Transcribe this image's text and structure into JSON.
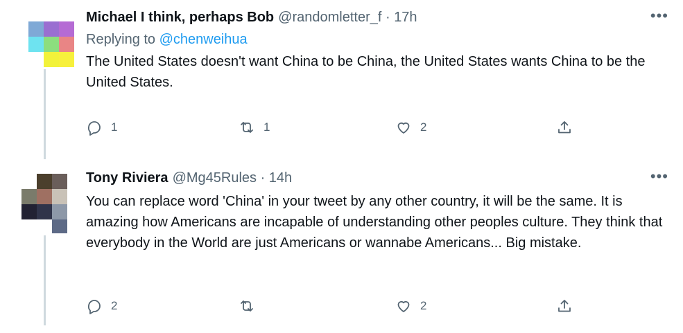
{
  "tweets": [
    {
      "name": "Michael I think, perhaps Bob",
      "meta": "@randomletter_f · 17h",
      "replying_prefix": "Replying to ",
      "replying_handle": "@chenweihua",
      "text": "The United States doesn't want China to be China, the United States wants China to be the United States.",
      "reply_count": "1",
      "retweet_count": "1",
      "like_count": "2",
      "more_glyph": "•••"
    },
    {
      "name": "Tony Riviera",
      "meta": "@Mg45Rules · 14h",
      "text": "You can replace word 'China' in your tweet by any other country, it will be the same. It is amazing how Americans are incapable of understanding other peoples culture. They think that everybody in the World are just Americans or wannabe Americans... Big mistake.",
      "reply_count": "2",
      "retweet_count": "",
      "like_count": "2",
      "more_glyph": "•••"
    }
  ],
  "colors": {
    "name": "#0f1419",
    "secondary": "#536471",
    "link": "#1d9bf0",
    "thread_line": "#cfd9de"
  },
  "icons": [
    "reply-icon",
    "retweet-icon",
    "like-icon",
    "share-icon",
    "more-icon"
  ]
}
